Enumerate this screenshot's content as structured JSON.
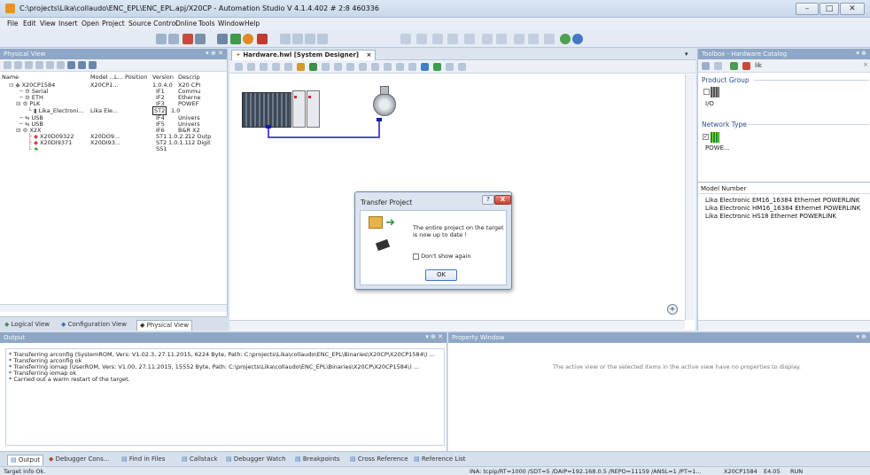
{
  "window": {
    "title": "C:\\projects\\Lika\\collaudo\\ENC_EPL\\ENC_EPL.apj/X20CP - Automation Studio V 4.1.4.402 # 2:8 460336"
  },
  "menu": [
    "File",
    "Edit",
    "View",
    "Insert",
    "Open",
    "Project",
    "Source Control",
    "Online",
    "Tools",
    "Window",
    "Help"
  ],
  "physical_view": {
    "title": "Physical View",
    "columns": [
      "Name",
      "Model ...",
      "L...",
      "Position",
      "Version",
      "Descrip"
    ],
    "rows": [
      {
        "name": "X20CP1584",
        "model": "X20CP1...",
        "position": "",
        "version": "1.0.4.0",
        "desc": "X20 CPI"
      },
      {
        "name": "Serial",
        "model": "",
        "position": "IF1",
        "version": "",
        "desc": "Commu"
      },
      {
        "name": "ETH",
        "model": "",
        "position": "IF2",
        "version": "",
        "desc": "Etherne"
      },
      {
        "name": "PLK",
        "model": "",
        "position": "IF3",
        "version": "",
        "desc": "POWEF"
      },
      {
        "name": "Lika_Electroni...",
        "model": "Lika Ele...",
        "position": "ST2",
        "version": "1.0",
        "desc": ""
      },
      {
        "name": "USB",
        "model": "",
        "position": "IF4",
        "version": "",
        "desc": "Univers"
      },
      {
        "name": "USB",
        "model": "",
        "position": "IF5",
        "version": "",
        "desc": "Univers"
      },
      {
        "name": "X2X",
        "model": "",
        "position": "IF6",
        "version": "",
        "desc": "B&R X2"
      },
      {
        "name": "X20D09322",
        "model": "X20DO9...",
        "position": "ST1",
        "version": "1.0.2.2",
        "desc": "12 Outp"
      },
      {
        "name": "X20DI9371",
        "model": "X20DI93...",
        "position": "ST2",
        "version": "1.0.1.1",
        "desc": "12 Digit"
      },
      {
        "name": "",
        "model": "",
        "position": "SS1",
        "version": "",
        "desc": ""
      }
    ],
    "tabs": [
      "Logical View",
      "Configuration View",
      "Physical View"
    ]
  },
  "designer": {
    "tab": "Hardware.hwl [System Designer]",
    "close": "×"
  },
  "dialog": {
    "title": "Transfer Project",
    "message": "The entire project on the target is now up to date !",
    "checkbox": "Don't show again",
    "ok": "OK",
    "help": "?",
    "close": "X"
  },
  "toolbox": {
    "title": "Toolbox - Hardware Catalog",
    "search": "lik",
    "clear": "×",
    "product_group": "Product Group",
    "product_item": "I/O",
    "network_type": "Network Type",
    "network_item": "POWE...",
    "model_header": "Model Number",
    "models": [
      "Lika Electronic EM16_16384 Ethernet POWERLINK",
      "Lika Electronic HM16_16384 Ethernet POWERLINK",
      "Lika Electronic HS18 Ethernet POWERLINK"
    ]
  },
  "output": {
    "title": "Output",
    "lines": [
      "* Transferring arconfig (SystemROM, Vers: V1.02.3, 27.11.2015, 6224 Byte, Path: C:\\projects\\Lika\\collaudo\\ENC_EPL\\Binaries\\X20CP\\X20CP1584\\) ...",
      "* Transferring arconfig ok",
      "* Transferring iomap (UserROM, Vers: V1.00, 27.11.2015, 15552 Byte, Path: C:\\projects\\Lika\\collaudo\\ENC_EPL\\Binaries\\X20CP\\X20CP1584\\) ...",
      "* Transferring iomap ok",
      "* Carried out a warm restart of the target."
    ],
    "tabs": [
      "Output",
      "Debugger Cons...",
      "Find in Files",
      "Callstack",
      "Debugger Watch",
      "Breakpoints",
      "Cross Reference",
      "Reference List"
    ]
  },
  "property": {
    "title": "Property Window",
    "message": "The active view or the selected items in the active view have no properties to display."
  },
  "status": {
    "left": "Target info Ok.",
    "connection": "INA: tcpip/RT=1000 /SDT=5 /DAIP=192.168.0.5 /REPO=11159 /ANSL=1 /PT=1...",
    "cpu": "X20CP1584",
    "version": "E4.05",
    "mode": "RUN"
  },
  "colors": {
    "accent": "#8fa7c6",
    "link": "#2b3fb3"
  }
}
